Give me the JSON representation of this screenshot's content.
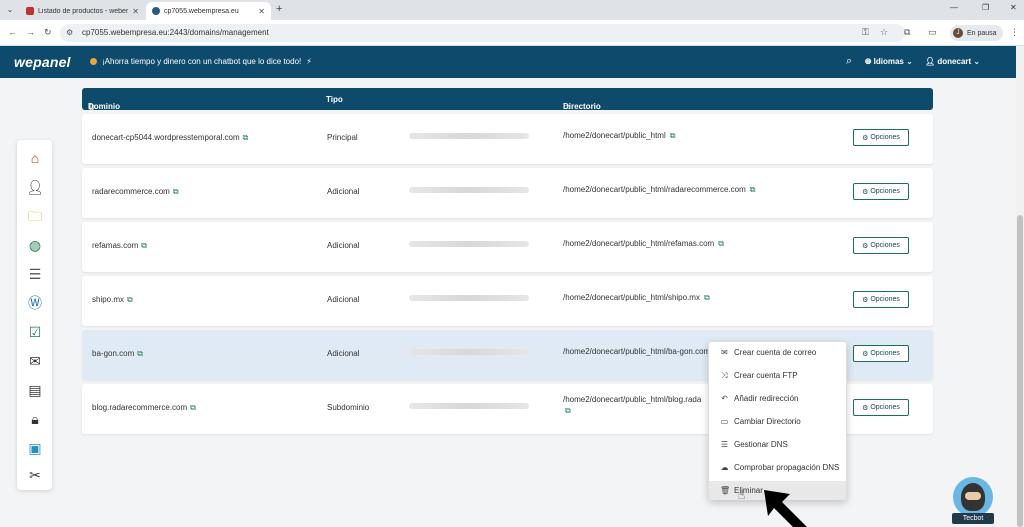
{
  "browser": {
    "tabs": [
      {
        "title": "Listado de productos - webem",
        "active": false
      },
      {
        "title": "cp7055.webempresa.eu",
        "active": true
      }
    ],
    "url": "cp7055.webempresa.eu:2443/domains/management",
    "profile_status": "En pausa",
    "profile_initial": "J"
  },
  "header": {
    "logo": "wepanel",
    "promo": "¡Ahorra tiempo y dinero con un chatbot que lo dice todo!",
    "lang_label": "Idiomas",
    "user_label": "donecart"
  },
  "table": {
    "columns": {
      "domain": "Dominio",
      "type": "Tipo",
      "directory": "Directorio"
    },
    "options_label": "Opciones",
    "rows": [
      {
        "domain": "donecart-cp5044.wordpresstemporal.com",
        "type": "Principal",
        "directory": "/home2/donecart/public_html"
      },
      {
        "domain": "radarecommerce.com",
        "type": "Adicional",
        "directory": "/home2/donecart/public_html/radarecommerce.com"
      },
      {
        "domain": "refamas.com",
        "type": "Adicional",
        "directory": "/home2/donecart/public_html/refamas.com"
      },
      {
        "domain": "shipo.mx",
        "type": "Adicional",
        "directory": "/home2/donecart/public_html/shipo.mx"
      },
      {
        "domain": "ba-gon.com",
        "type": "Adicional",
        "directory": "/home2/donecart/public_html/ba-gon.com"
      },
      {
        "domain": "blog.radarecommerce.com",
        "type": "Subdominio",
        "directory": "/home2/donecart/public_html/blog.rada"
      }
    ]
  },
  "dropdown": {
    "items": [
      {
        "label": "Crear cuenta de correo",
        "icon": "envelope-icon"
      },
      {
        "label": "Crear cuenta FTP",
        "icon": "shuffle-icon"
      },
      {
        "label": "Añadir redirección",
        "icon": "reply-icon"
      },
      {
        "label": "Cambiar Directorio",
        "icon": "folder-icon"
      },
      {
        "label": "Gestionar DNS",
        "icon": "list-icon"
      },
      {
        "label": "Comprobar propagación DNS",
        "icon": "cloud-icon"
      },
      {
        "label": "Eliminar",
        "icon": "trash-icon"
      }
    ]
  },
  "dock": {
    "icons": [
      "home-icon",
      "user-settings-icon",
      "folder-icon",
      "globe-icon",
      "database-icon",
      "wordpress-icon",
      "browser-check-icon",
      "mail-icon",
      "report-icon",
      "lock-icon",
      "toolbox-icon",
      "tools-icon"
    ]
  },
  "chat": {
    "label": "Tecbot"
  }
}
